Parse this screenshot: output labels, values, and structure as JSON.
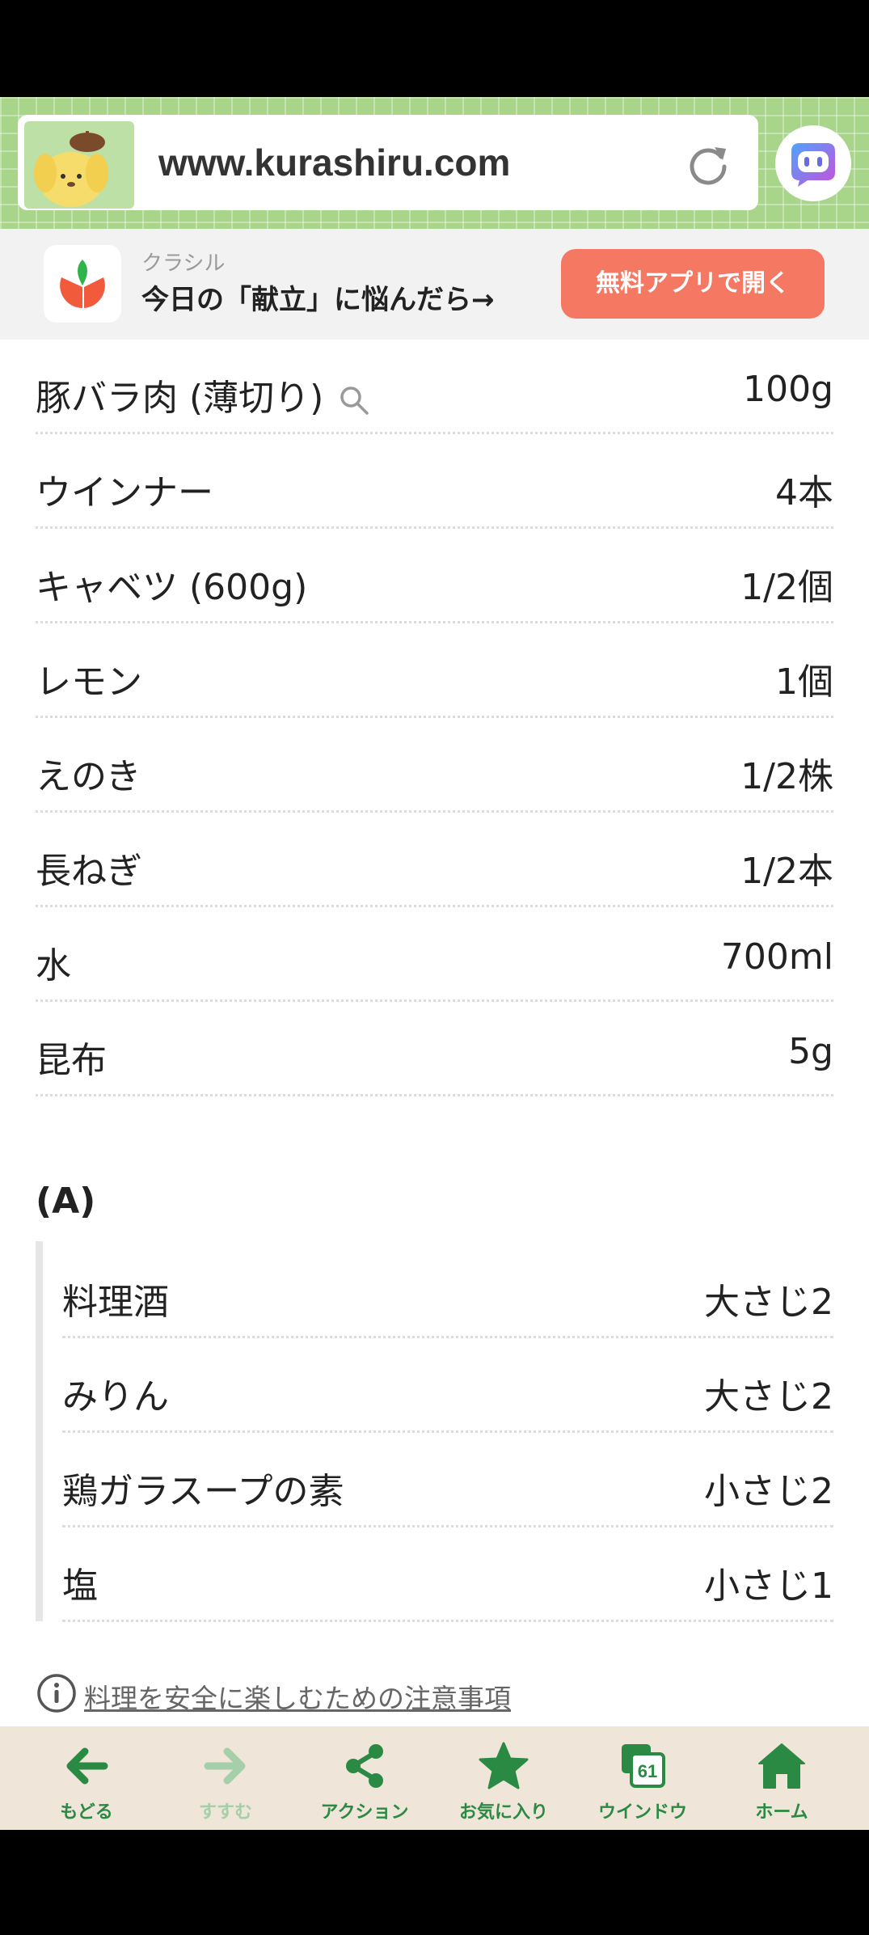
{
  "browser": {
    "url": "www.kurashiru.com"
  },
  "app_banner": {
    "app_name": "クラシル",
    "tagline": "今日の「献立」に悩んだら→",
    "open_button": "無料アプリで開く"
  },
  "ingredients": [
    {
      "name": "豚バラ肉 (薄切り)",
      "amount": "100g"
    },
    {
      "name": "ウインナー",
      "amount": "4本"
    },
    {
      "name": "キャベツ (600g)",
      "amount": "1/2個"
    },
    {
      "name": "レモン",
      "amount": "1個"
    },
    {
      "name": "えのき",
      "amount": "1/2株"
    },
    {
      "name": "長ねぎ",
      "amount": "1/2本"
    },
    {
      "name": "水",
      "amount": "700ml"
    },
    {
      "name": "昆布",
      "amount": "5g"
    }
  ],
  "group_a": {
    "heading": "(A)",
    "items": [
      {
        "name": "料理酒",
        "amount": "大さじ2"
      },
      {
        "name": "みりん",
        "amount": "大さじ2"
      },
      {
        "name": "鶏ガラスープの素",
        "amount": "小さじ2"
      },
      {
        "name": "塩",
        "amount": "小さじ1"
      }
    ]
  },
  "notice_link": "料理を安全に楽しむための注意事項",
  "bottom_nav": [
    {
      "label": "もどる",
      "icon": "arrow-left-icon"
    },
    {
      "label": "すすむ",
      "icon": "arrow-right-icon"
    },
    {
      "label": "アクション",
      "icon": "share-icon"
    },
    {
      "label": "お気に入り",
      "icon": "star-icon"
    },
    {
      "label": "ウインドウ",
      "icon": "window-icon",
      "badge": "61"
    },
    {
      "label": "ホーム",
      "icon": "home-icon"
    }
  ],
  "colors": {
    "header_green": "#a8d58a",
    "open_button": "#f47862",
    "nav_green": "#2a8a43",
    "nav_background": "#efe5d8"
  }
}
